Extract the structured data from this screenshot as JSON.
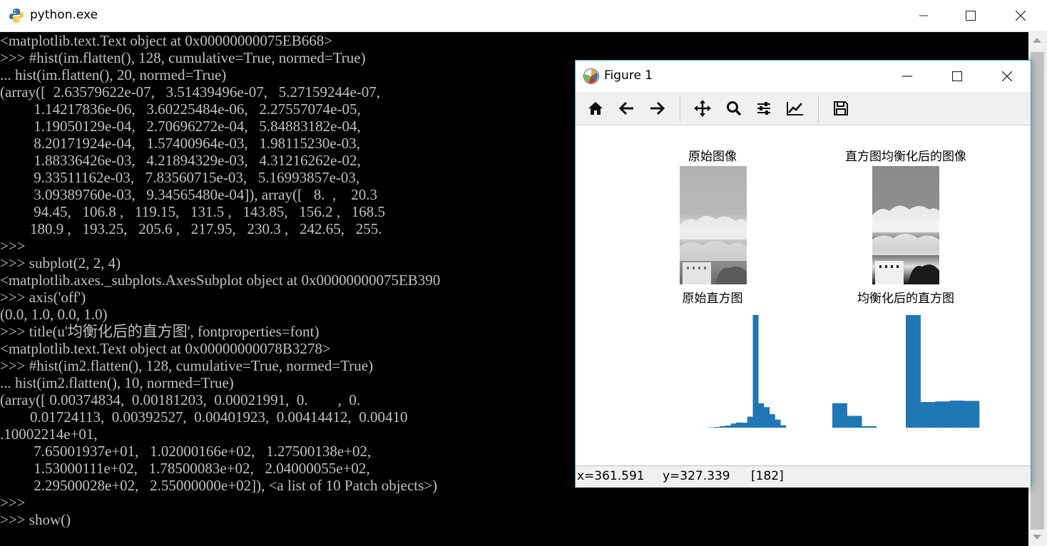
{
  "console": {
    "title": "python.exe",
    "lines": [
      "<matplotlib.text.Text object at 0x00000000075EB668>",
      ">>> #hist(im.flatten(), 128, cumulative=True, normed=True)",
      "... hist(im.flatten(), 20, normed=True)",
      "(array([  2.63579622e-07,   3.51439496e-07,   5.27159244e-07,",
      "         1.14217836e-06,   3.60225484e-06,   2.27557074e-05,",
      "         1.19050129e-04,   2.70696272e-04,   5.84883182e-04,",
      "         8.20171924e-04,   1.57400964e-03,   1.98115230e-03,",
      "         1.88336426e-03,   4.21894329e-03,   4.31216262e-02,",
      "         9.33511162e-03,   7.83560715e-03,   5.16993857e-03,",
      "         3.09389760e-03,   9.34565480e-04]), array([   8.  ,    20.3",
      "         94.45,   106.8 ,   119.15,   131.5 ,   143.85,   156.2 ,   168.5",
      "        180.9 ,   193.25,   205.6 ,   217.95,   230.3 ,   242.65,   255.",
      ">>>",
      ">>> subplot(2, 2, 4)",
      "<matplotlib.axes._subplots.AxesSubplot object at 0x00000000075EB390",
      ">>> axis('off')",
      "(0.0, 1.0, 0.0, 1.0)",
      ">>> title(u'均衡化后的直方图', fontproperties=font)",
      "<matplotlib.text.Text object at 0x00000000078B3278>",
      ">>> #hist(im2.flatten(), 128, cumulative=True, normed=True)",
      "... hist(im2.flatten(), 10, normed=True)",
      "(array([ 0.00374834,  0.00181203,  0.00021991,  0.        ,  0.",
      "        0.01724113,  0.00392527,  0.00401923,  0.00414412,  0.00410",
      ".10002214e+01,",
      "         7.65001937e+01,   1.02000166e+02,   1.27500138e+02,",
      "         1.53000111e+02,   1.78500083e+02,   2.04000055e+02,",
      "         2.29500028e+02,   2.55000000e+02]), <a list of 10 Patch objects>)",
      ">>>",
      ">>> show()"
    ]
  },
  "figure": {
    "title": "Figure 1",
    "toolbar": [
      "home-icon",
      "back-arrow-icon",
      "forward-arrow-icon",
      "pan-icon",
      "zoom-icon",
      "configure-subplots-icon",
      "edit-axis-icon",
      "save-icon"
    ],
    "status": {
      "x": "x=361.591",
      "y": "y=327.339",
      "value": "[182]"
    }
  },
  "chart_data": [
    {
      "type": "image",
      "title": "原始图像"
    },
    {
      "type": "image",
      "title": "直方图均衡化后的图像"
    },
    {
      "type": "bar",
      "title": "原始直方图",
      "bins": 20,
      "values": [
        2.63579622e-07,
        3.51439496e-07,
        5.27159244e-07,
        1.14217836e-06,
        3.60225484e-06,
        2.27557074e-05,
        0.000119050129,
        0.000270696272,
        0.000584883182,
        0.000820171924,
        0.00157400964,
        0.0019811523,
        0.00188336426,
        0.00421894329,
        0.0431216262,
        0.00933511162,
        0.00783560715,
        0.00516993857,
        0.0030938976,
        0.00093456548
      ],
      "color": "#1f77b4"
    },
    {
      "type": "bar",
      "title": "均衡化后的直方图",
      "bins": 10,
      "values": [
        0.00374834,
        0.00181203,
        0.00021991,
        0.0,
        0.0,
        0.01724113,
        0.00392527,
        0.00401923,
        0.00414412,
        0.0041
      ],
      "color": "#1f77b4"
    }
  ]
}
